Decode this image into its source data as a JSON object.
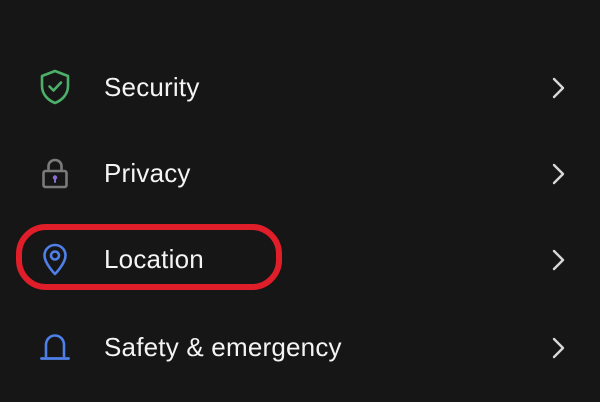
{
  "settings": {
    "items": [
      {
        "label": "Security",
        "icon": "shield-check-icon",
        "icon_color": "#4caf6a"
      },
      {
        "label": "Privacy",
        "icon": "lock-icon",
        "icon_color": "#7a7a7a",
        "icon_accent": "#8a6fd1"
      },
      {
        "label": "Location",
        "icon": "map-pin-icon",
        "icon_color": "#4f7fe8"
      },
      {
        "label": "Safety & emergency",
        "icon": "siren-icon",
        "icon_color": "#4f7fe8"
      }
    ],
    "chevron_icon": "chevron-right-icon",
    "chevron_color": "#d8d8d8"
  },
  "annotation": {
    "highlight_color": "#e01e2a",
    "highlighted_item": "Location"
  },
  "colors": {
    "background": "#161616",
    "text": "#f4f4f4"
  }
}
